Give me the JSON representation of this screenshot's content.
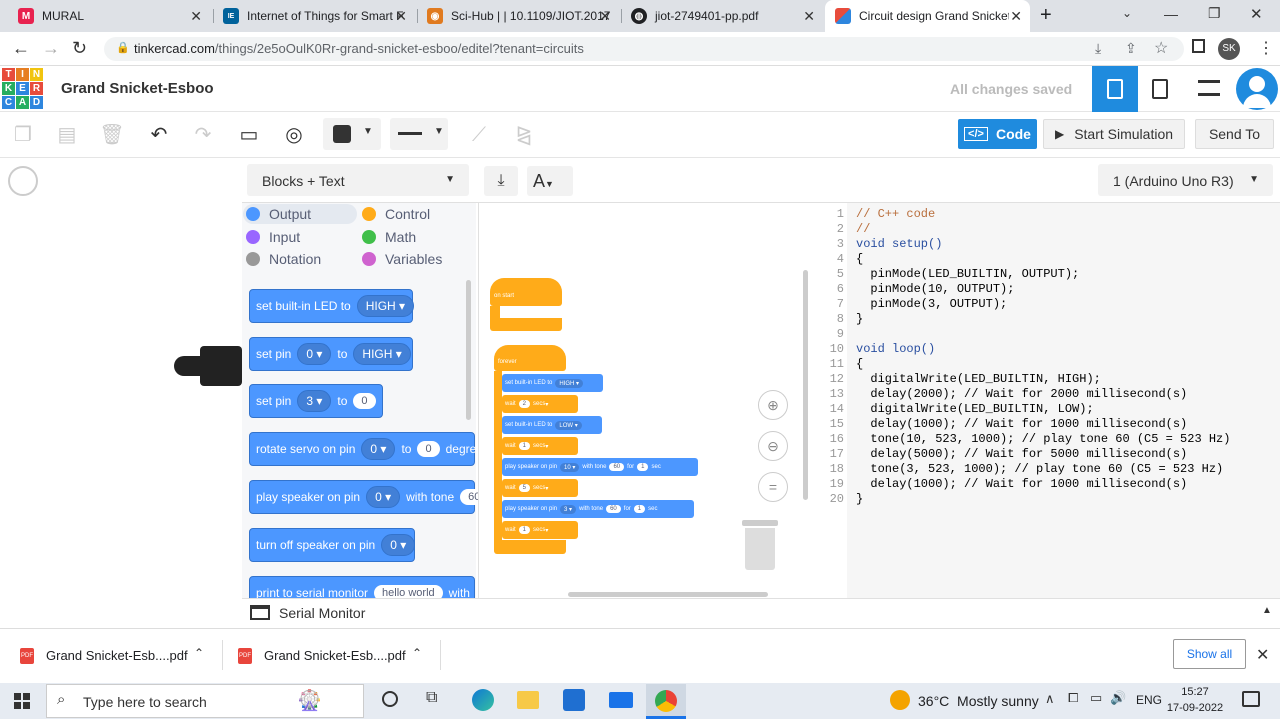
{
  "browser": {
    "tabs": [
      {
        "title": "MURAL",
        "icon": "mural-icon",
        "color": "#e8224f"
      },
      {
        "title": "Internet of Things for Smart F",
        "icon": "ieee-icon",
        "color": "#00629b"
      },
      {
        "title": "Sci-Hub | | 10.1109/JIOT.2017",
        "icon": "scihub-icon",
        "color": "#e07a1f"
      },
      {
        "title": "jiot-2749401-pp.pdf",
        "icon": "globe-icon",
        "color": "#202124"
      },
      {
        "title": "Circuit design Grand Snicket-",
        "icon": "tinkercad-icon",
        "color": "#e74c3c"
      }
    ],
    "url_host": "tinkercad.com",
    "url_path": "/things/2e5oOulK0Rr-grand-snicket-esboo/editel?tenant=circuits",
    "profile": "SK"
  },
  "app": {
    "logo_letters": [
      "T",
      "I",
      "N",
      "K",
      "E",
      "R",
      "C",
      "A",
      "D"
    ],
    "title": "Grand Snicket-Esboo",
    "save_status": "All changes saved",
    "code_button": "Code",
    "start_sim": "Start Simulation",
    "send_to": "Send To",
    "blocks_mode": "Blocks + Text",
    "device": "1 (Arduino Uno R3)",
    "serial_monitor": "Serial Monitor"
  },
  "categories": [
    {
      "label": "Output",
      "color": "#4c97ff"
    },
    {
      "label": "Control",
      "color": "#ffab19"
    },
    {
      "label": "Input",
      "color": "#9966ff"
    },
    {
      "label": "Math",
      "color": "#40bf4a"
    },
    {
      "label": "Notation",
      "color": "#999999"
    },
    {
      "label": "Variables",
      "color": "#cf63cf"
    }
  ],
  "palette_blocks": {
    "b1": {
      "text": "set built-in LED to",
      "val": "HIGH"
    },
    "b2": {
      "text": "set pin",
      "pin": "0",
      "to": "to",
      "val": "HIGH"
    },
    "b3": {
      "text": "set pin",
      "pin": "3",
      "to": "to",
      "val": "0"
    },
    "b4": {
      "text": "rotate servo on pin",
      "pin": "0",
      "to": "to",
      "val": "0",
      "tail": "degre"
    },
    "b5": {
      "text": "play speaker on pin",
      "pin": "0",
      "mid": "with tone",
      "val": "60"
    },
    "b6": {
      "text": "turn off speaker on pin",
      "pin": "0"
    },
    "b7": {
      "text": "print to serial monitor",
      "val": "hello world",
      "tail": "with"
    }
  },
  "workspace": {
    "on_start": "on start",
    "forever": "forever",
    "s1": {
      "text": "set built-in LED to",
      "val": "HIGH"
    },
    "w1": {
      "text": "wait",
      "val": "2",
      "unit": "secs"
    },
    "s2": {
      "text": "set built-in LED to",
      "val": "LOW"
    },
    "w2": {
      "text": "wait",
      "val": "1",
      "unit": "secs"
    },
    "s3": {
      "text": "play speaker on pin",
      "pin": "10",
      "mid": "with tone",
      "tone": "60",
      "for": "for",
      "dur": "1",
      "unit": "sec"
    },
    "w3": {
      "text": "wait",
      "val": "5",
      "unit": "secs"
    },
    "s4": {
      "text": "play speaker on pin",
      "pin": "3",
      "mid": "with tone",
      "tone": "60",
      "for": "for",
      "dur": "1",
      "unit": "sec"
    },
    "w4": {
      "text": "wait",
      "val": "1",
      "unit": "secs"
    }
  },
  "code_lines": [
    "// C++ code",
    "//",
    "void setup()",
    "{",
    "  pinMode(LED_BUILTIN, OUTPUT);",
    "  pinMode(10, OUTPUT);",
    "  pinMode(3, OUTPUT);",
    "}",
    "",
    "void loop()",
    "{",
    "  digitalWrite(LED_BUILTIN, HIGH);",
    "  delay(2000); // Wait for 2000 millisecond(s)",
    "  digitalWrite(LED_BUILTIN, LOW);",
    "  delay(1000); // Wait for 1000 millisecond(s)",
    "  tone(10, 523, 1000); // play tone 60 (C5 = 523 Hz)",
    "  delay(5000); // Wait for 5000 millisecond(s)",
    "  tone(3, 523, 1000); // play tone 60 (C5 = 523 Hz)",
    "  delay(1000); // Wait for 1000 millisecond(s)",
    "}"
  ],
  "downloads": {
    "items": [
      "Grand Snicket-Esb....pdf",
      "Grand Snicket-Esb....pdf"
    ],
    "show_all": "Show all"
  },
  "taskbar": {
    "search_placeholder": "Type here to search",
    "weather": "36°C  Mostly sunny",
    "lang": "ENG",
    "time": "15:27",
    "date": "17-09-2022"
  }
}
